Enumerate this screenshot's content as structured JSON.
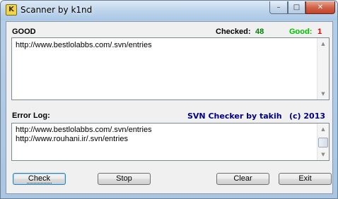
{
  "window": {
    "title": "Scanner by k1nd",
    "app_icon_glyph": "K",
    "minimize_glyph": "–",
    "maximize_glyph": "□",
    "close_glyph": "✕"
  },
  "header": {
    "good_label": "GOOD",
    "checked_label": "Checked:",
    "checked_count": "48",
    "good_count_label": "Good:",
    "good_count": "1"
  },
  "good_list": {
    "items": [
      "http://www.bestlolabbs.com/.svn/entries"
    ]
  },
  "error_section": {
    "label": "Error Log:",
    "credit": "SVN Checker by takih",
    "copyright": "(c) 2013"
  },
  "error_list": {
    "items": [
      "http://www.bestlolabbs.com/.svn/entries",
      "http://www.rouhani.ir/.svn/entries"
    ]
  },
  "scroll_arrows": {
    "up": "▲",
    "down": "▼"
  },
  "buttons": {
    "check": "Check",
    "stop": "Stop",
    "clear": "Clear",
    "exit": "Exit"
  },
  "colors": {
    "checked_count": "#008000",
    "good_count_label": "#00c000",
    "good_count": "#e00000",
    "credit": "#000080"
  }
}
